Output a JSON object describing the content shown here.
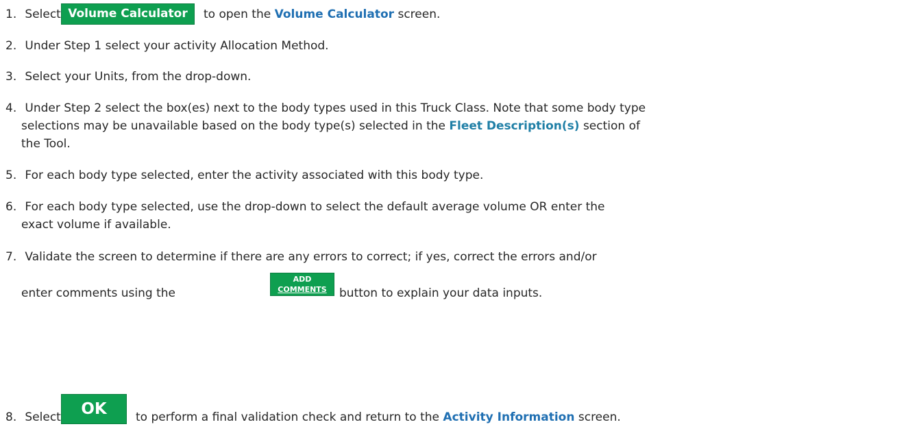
{
  "steps": [
    {
      "num": "1.",
      "pre": "Select",
      "button": "Volume Calculator",
      "mid": "to open the",
      "link": "Volume Calculator",
      "post": "screen."
    },
    {
      "num": "2.",
      "text": "Under Step 1 select your activity Allocation Method."
    },
    {
      "num": "3.",
      "text": "Select your Units, from the drop-down."
    },
    {
      "num": "4.",
      "line1": "Under Step 2 select the box(es) next to the body types used in this Truck Class. Note that some body type",
      "line2_pre": "selections may be unavailable based on the body type(s) selected in the",
      "link": "Fleet Description(s)",
      "line2_post": "section of",
      "line3": "the Tool."
    },
    {
      "num": "5.",
      "text": "For each body type selected, enter the activity associated with this body type."
    },
    {
      "num": "6.",
      "line1": "For each body type selected, use the drop-down to select the default average volume OR enter the",
      "line2": "exact volume if available."
    },
    {
      "num": "7.",
      "line1": "Validate the screen to determine if there are any errors to correct; if yes, correct the errors and/or",
      "line2_pre": "enter comments using the",
      "button_l1": "ADD",
      "button_l2": "COMMENTS",
      "line2_post": "button to explain your data inputs."
    },
    {
      "num": "8.",
      "pre": "Select",
      "button": "OK",
      "mid": "to perform a final validation check and return to the",
      "link": "Activity Information",
      "post": "screen."
    }
  ],
  "colors": {
    "button_green": "#0e9f50",
    "link_blue": "#1f6fb2"
  }
}
